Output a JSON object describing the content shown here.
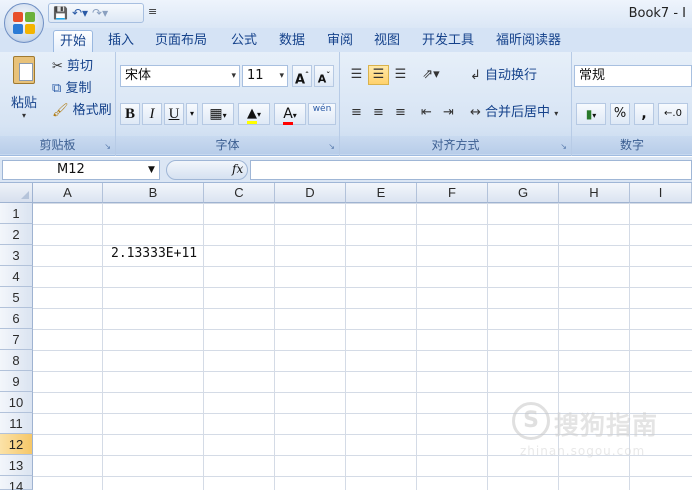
{
  "window": {
    "title": "Book7 - I"
  },
  "qat": {
    "more": "≡"
  },
  "tabs": [
    {
      "label": "开始",
      "active": true
    },
    {
      "label": "插入"
    },
    {
      "label": "页面布局"
    },
    {
      "label": "公式"
    },
    {
      "label": "数据"
    },
    {
      "label": "审阅"
    },
    {
      "label": "视图"
    },
    {
      "label": "开发工具"
    },
    {
      "label": "福昕阅读器"
    }
  ],
  "ribbon": {
    "clipboard": {
      "label": "剪贴板",
      "paste": "粘贴",
      "cut": "剪切",
      "copy": "复制",
      "format_painter": "格式刷"
    },
    "font": {
      "label": "字体",
      "name": "宋体",
      "size": "11",
      "bold": "B",
      "italic": "I",
      "underline": "U",
      "phonetic": "wén"
    },
    "alignment": {
      "label": "对齐方式",
      "wrap": "自动换行",
      "merge": "合并后居中"
    },
    "number": {
      "label": "数字",
      "format": "常规",
      "percent": "%",
      "comma": ","
    }
  },
  "formula_bar": {
    "name_box": "M12",
    "fx": "fx",
    "value": ""
  },
  "grid": {
    "columns": [
      "A",
      "B",
      "C",
      "D",
      "E",
      "F",
      "G",
      "H",
      "I"
    ],
    "rows": [
      "1",
      "2",
      "3",
      "4",
      "5",
      "6",
      "7",
      "8",
      "9",
      "10",
      "11",
      "12",
      "13",
      "14"
    ],
    "selected_row": "12",
    "cells": {
      "B3": "2.13333E+11"
    }
  },
  "watermark": {
    "text": "搜狗指南",
    "url": "zhinan.sogou.com"
  },
  "colors": {
    "accent": "#15428b",
    "ribbon_bg": "#d7e4f4",
    "selected_row": "#f6c768"
  }
}
